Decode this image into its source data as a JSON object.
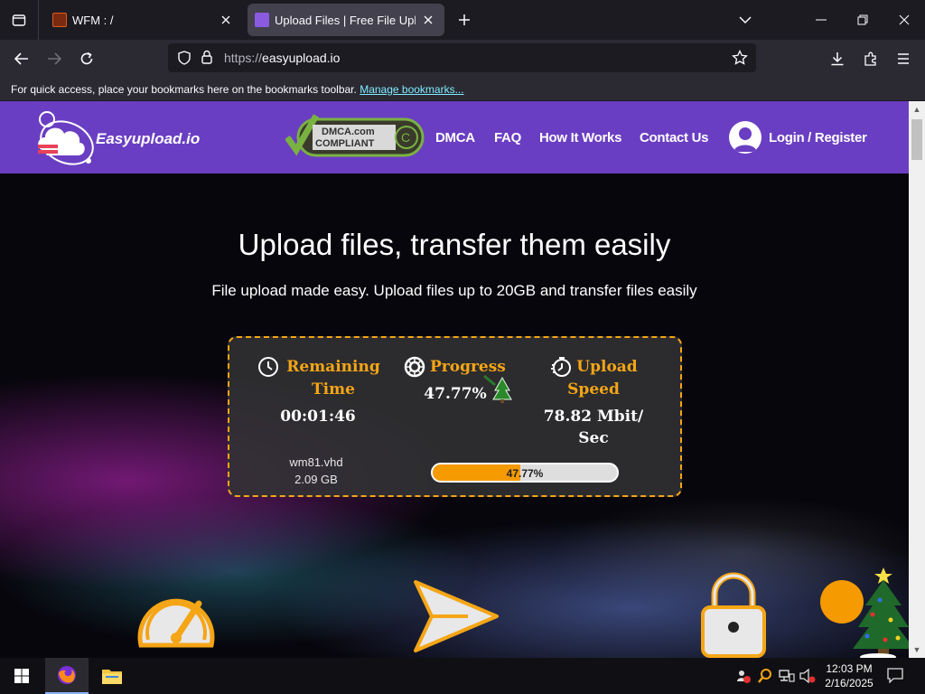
{
  "browser": {
    "tabs": [
      {
        "title": "WFM : /"
      },
      {
        "title": "Upload Files | Free File Upload a"
      }
    ],
    "url_protocol": "https://",
    "url_host": "easyupload.io",
    "bookmarks_text": "For quick access, place your bookmarks here on the bookmarks toolbar.",
    "bookmarks_link": "Manage bookmarks..."
  },
  "site": {
    "brand": "Easyupload.io",
    "dmca_line1": "DMCA.com",
    "dmca_line2": "COMPLIANT",
    "menu": [
      "DMCA",
      "FAQ",
      "How It Works",
      "Contact Us"
    ],
    "login": "Login / Register",
    "accent": "#6a3ec2"
  },
  "hero": {
    "title": "Upload files, transfer them easily",
    "subtitle": "File upload made easy. Upload files up to 20GB and transfer files easily"
  },
  "upload": {
    "remaining_label_1": "Remaining",
    "remaining_label_2": "Time",
    "remaining_value": "00:01:46",
    "progress_label": "Progress",
    "progress_value": "47.77%",
    "progress_fraction": 0.4777,
    "speed_label_1": "Upload",
    "speed_label_2": "Speed",
    "speed_value_1": "78.82 Mbit/",
    "speed_value_2": "Sec",
    "file_name": "wm81.vhd",
    "file_size": "2.09 GB",
    "bar_text": "47.77%",
    "accent": "#f5a516"
  },
  "taskbar": {
    "time": "12:03 PM",
    "date": "2/16/2025"
  }
}
